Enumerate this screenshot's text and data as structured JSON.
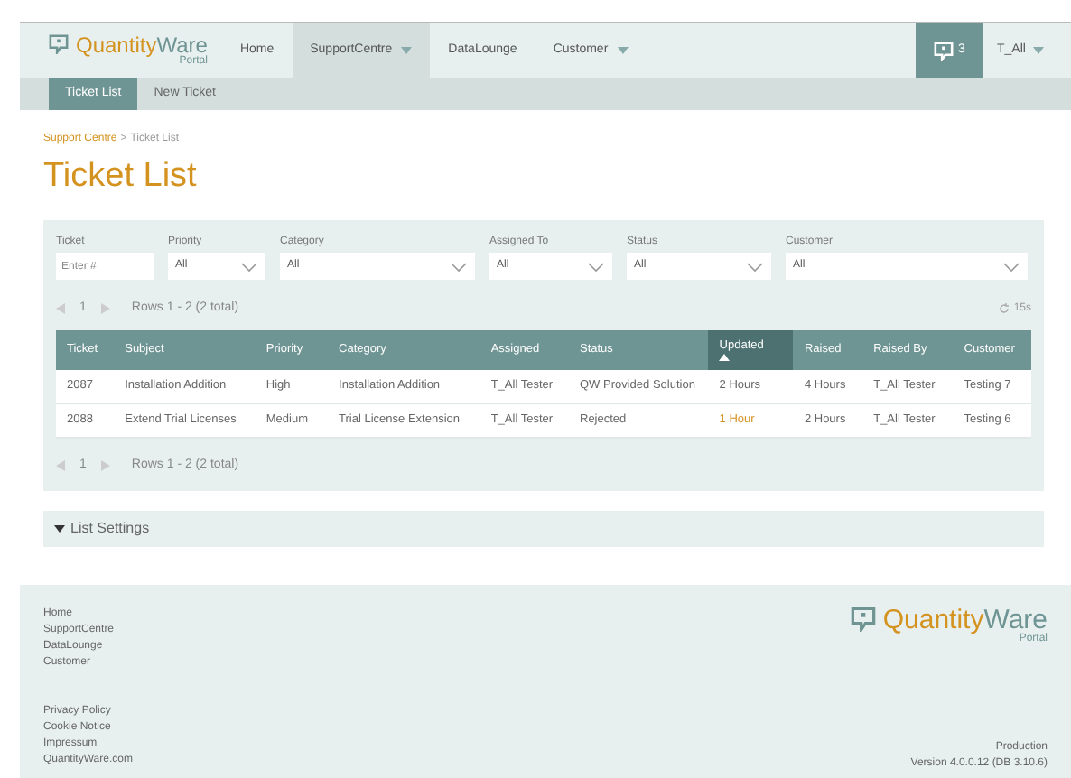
{
  "brand": {
    "name_a": "Quantity",
    "name_b": "Ware",
    "sub": "Portal"
  },
  "footer_brand": {
    "name_a": "Quantity",
    "name_b": "Ware",
    "sub": "Portal"
  },
  "nav": [
    {
      "label": "Home",
      "selected": false,
      "has_menu": false
    },
    {
      "label": "SupportCentre",
      "selected": true,
      "has_menu": true
    },
    {
      "label": "DataLounge",
      "selected": false,
      "has_menu": false
    },
    {
      "label": "Customer",
      "selected": false,
      "has_menu": true
    }
  ],
  "notifications": {
    "count": "3"
  },
  "user": {
    "label": "T_All",
    "has_menu": true
  },
  "subnav": [
    {
      "label": "Ticket List",
      "selected": true
    },
    {
      "label": "New Ticket",
      "selected": false
    }
  ],
  "breadcrumb": {
    "parent": "Support Centre",
    "separator": ">",
    "current": "Ticket List"
  },
  "page_title": "Ticket List",
  "filters": [
    {
      "label": "Ticket",
      "kind": "input",
      "placeholder": "Enter #"
    },
    {
      "label": "Priority",
      "kind": "select",
      "value": "All"
    },
    {
      "label": "Category",
      "kind": "select",
      "value": "All"
    },
    {
      "label": "Assigned To",
      "kind": "select",
      "value": "All"
    },
    {
      "label": "Status",
      "kind": "select",
      "value": "All"
    },
    {
      "label": "Customer",
      "kind": "select",
      "value": "All"
    }
  ],
  "pager": {
    "page": "1",
    "summary": "Rows 1 - 2 (2 total)"
  },
  "refresh": "15s",
  "table": {
    "columns": [
      {
        "label": "Ticket",
        "sorted": false
      },
      {
        "label": "Subject",
        "sorted": false
      },
      {
        "label": "Priority",
        "sorted": false
      },
      {
        "label": "Category",
        "sorted": false
      },
      {
        "label": "Assigned",
        "sorted": false
      },
      {
        "label": "Status",
        "sorted": false
      },
      {
        "label": "Updated",
        "sorted": true
      },
      {
        "label": "Raised",
        "sorted": false
      },
      {
        "label": "Raised By",
        "sorted": false
      },
      {
        "label": "Customer",
        "sorted": false
      }
    ],
    "rows": [
      {
        "cells": [
          "2087",
          "Installation Addition",
          "High",
          "Installation Addition",
          "T_All Tester",
          "QW Provided Solution",
          "2 Hours",
          "4 Hours",
          "T_All Tester",
          "Testing 7"
        ],
        "recent": false
      },
      {
        "cells": [
          "2088",
          "Extend Trial Licenses",
          "Medium",
          "Trial License Extension",
          "T_All Tester",
          "Rejected",
          "1 Hour",
          "2 Hours",
          "T_All Tester",
          "Testing 6"
        ],
        "recent": true
      }
    ]
  },
  "pager_bottom": {
    "page": "1",
    "summary": "Rows 1 - 2 (2 total)"
  },
  "list_settings": {
    "label": "List Settings",
    "expanded": false
  },
  "footer": {
    "links": [
      "Home",
      "SupportCentre",
      "DataLounge",
      "Customer"
    ],
    "legal": [
      "Privacy Policy",
      "Cookie Notice",
      "Impressum",
      "QuantityWare.com"
    ],
    "environment": "Production",
    "version": "Version 4.0.0.12 (DB 3.10.6)"
  }
}
